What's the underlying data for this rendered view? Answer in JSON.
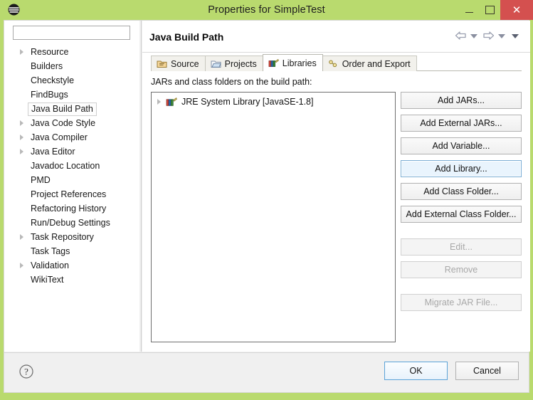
{
  "window": {
    "title": "Properties for SimpleTest",
    "app_icon": "eclipse-icon",
    "minimize_label": "",
    "maximize_label": "",
    "close_label": "✕",
    "titlebar_color": "#b9da6e",
    "close_color": "#d4504f"
  },
  "sidebar": {
    "filter": {
      "value": "",
      "placeholder": ""
    },
    "items": [
      {
        "label": "Resource",
        "expandable": true,
        "selected": false
      },
      {
        "label": "Builders",
        "expandable": false,
        "selected": false
      },
      {
        "label": "Checkstyle",
        "expandable": false,
        "selected": false
      },
      {
        "label": "FindBugs",
        "expandable": false,
        "selected": false
      },
      {
        "label": "Java Build Path",
        "expandable": false,
        "selected": true
      },
      {
        "label": "Java Code Style",
        "expandable": true,
        "selected": false
      },
      {
        "label": "Java Compiler",
        "expandable": true,
        "selected": false
      },
      {
        "label": "Java Editor",
        "expandable": true,
        "selected": false
      },
      {
        "label": "Javadoc Location",
        "expandable": false,
        "selected": false
      },
      {
        "label": "PMD",
        "expandable": false,
        "selected": false
      },
      {
        "label": "Project References",
        "expandable": false,
        "selected": false
      },
      {
        "label": "Refactoring History",
        "expandable": false,
        "selected": false
      },
      {
        "label": "Run/Debug Settings",
        "expandable": false,
        "selected": false
      },
      {
        "label": "Task Repository",
        "expandable": true,
        "selected": false
      },
      {
        "label": "Task Tags",
        "expandable": false,
        "selected": false
      },
      {
        "label": "Validation",
        "expandable": true,
        "selected": false
      },
      {
        "label": "WikiText",
        "expandable": false,
        "selected": false
      }
    ]
  },
  "main": {
    "page_title": "Java Build Path",
    "nav": {
      "back_icon": "arrow-left-icon",
      "back_menu_icon": "chevron-down-icon",
      "forward_icon": "arrow-right-icon",
      "forward_menu_icon": "chevron-down-icon",
      "view_menu_icon": "chevron-down-icon"
    },
    "tabs": [
      {
        "label": "Source",
        "icon": "source-folder-icon",
        "active": false
      },
      {
        "label": "Projects",
        "icon": "project-folder-icon",
        "active": false
      },
      {
        "label": "Libraries",
        "icon": "libraries-icon",
        "active": true
      },
      {
        "label": "Order and Export",
        "icon": "order-export-icon",
        "active": false
      }
    ],
    "libraries": {
      "list_label": "JARs and class folders on the build path:",
      "entries": [
        {
          "label": "JRE System Library [JavaSE-1.8]",
          "expandable": true,
          "icon": "libraries-icon"
        }
      ],
      "buttons": [
        {
          "label": "Add JARs...",
          "state": "normal"
        },
        {
          "label": "Add External JARs...",
          "state": "normal"
        },
        {
          "label": "Add Variable...",
          "state": "normal"
        },
        {
          "label": "Add Library...",
          "state": "focused"
        },
        {
          "label": "Add Class Folder...",
          "state": "normal"
        },
        {
          "label": "Add External Class Folder...",
          "state": "normal"
        },
        {
          "label": "Edit...",
          "state": "disabled"
        },
        {
          "label": "Remove",
          "state": "disabled"
        },
        {
          "label": "Migrate JAR File...",
          "state": "disabled"
        }
      ]
    }
  },
  "footer": {
    "help_icon": "help-question-icon",
    "ok_label": "OK",
    "cancel_label": "Cancel",
    "focus_color": "#5ba3d8"
  }
}
